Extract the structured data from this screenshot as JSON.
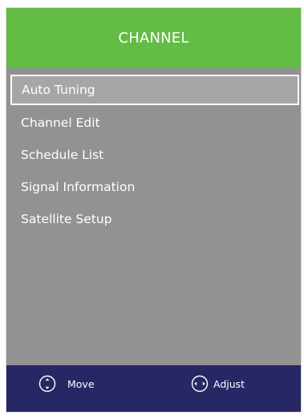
{
  "header": {
    "title": "CHANNEL"
  },
  "menu": {
    "selected_index": 0,
    "items": [
      {
        "label": "Auto Tuning"
      },
      {
        "label": "Channel Edit"
      },
      {
        "label": "Schedule List"
      },
      {
        "label": "Signal Information"
      },
      {
        "label": "Satellite Setup"
      }
    ]
  },
  "footer": {
    "move": {
      "label": "Move",
      "icon": "up-down-arrows-icon"
    },
    "adjust": {
      "label": "Adjust",
      "icon": "left-right-arrows-icon"
    }
  },
  "colors": {
    "header_bg": "#62bc45",
    "panel_bg": "#929292",
    "selected_bg": "#a6a6a6",
    "footer_bg": "#272766",
    "text": "#ffffff"
  }
}
